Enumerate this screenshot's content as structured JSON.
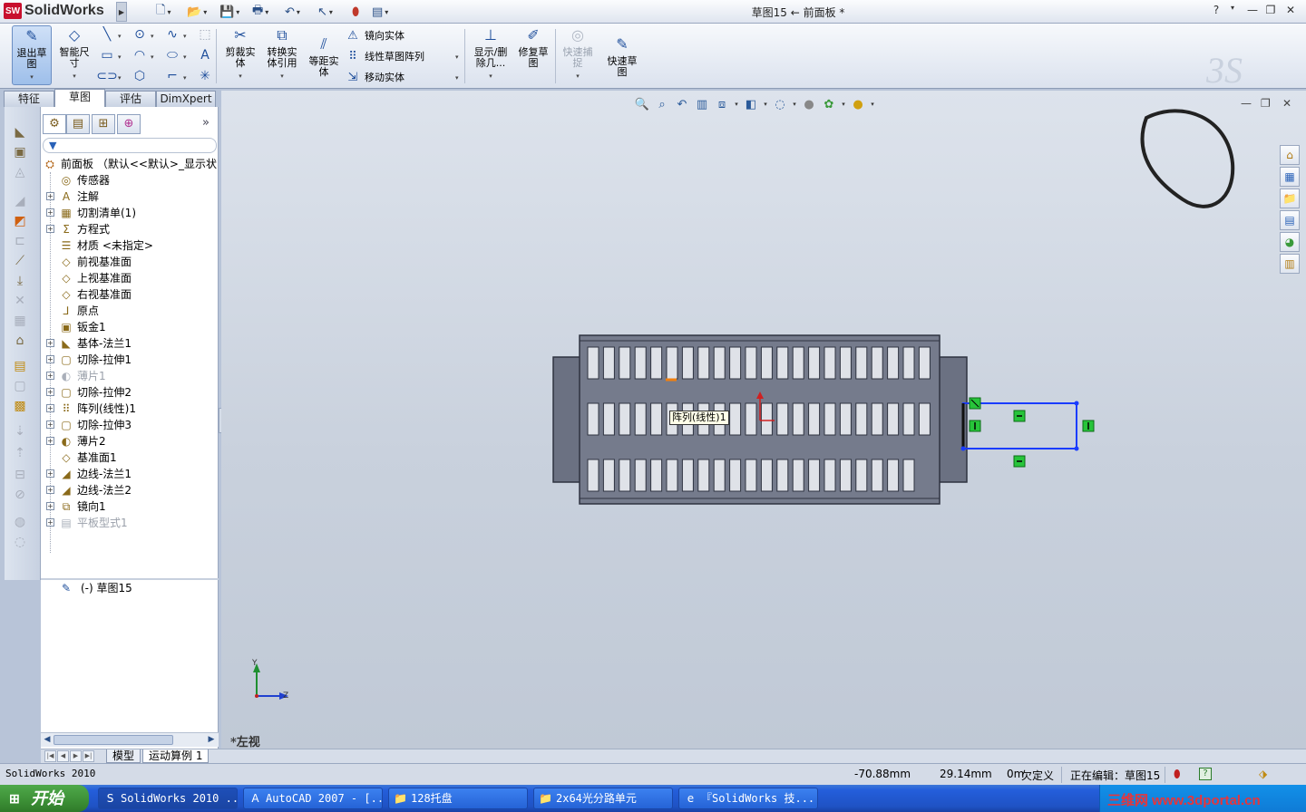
{
  "app": {
    "name": "SolidWorks",
    "document_title": "草图15 ← 前面板 *"
  },
  "window_controls": {
    "help": "?",
    "minimize": "—",
    "restore": "❐",
    "close": "✕"
  },
  "command_manager": {
    "exit_sketch": "退出草图",
    "smart_dimension": "智能尺寸",
    "trim_entities": "剪裁实体",
    "convert_entities": "转换实体引用",
    "offset_entities": "等距实体",
    "mirror_entities": "镜向实体",
    "linear_pattern": "线性草图阵列",
    "move_entities": "移动实体",
    "display_delete_relations": "显示/删除几...",
    "repair_sketch": "修复草图",
    "quick_snaps": "快速捕捉",
    "rapid_sketch": "快速草图"
  },
  "tabs": [
    "特征",
    "草图",
    "评估",
    "DimXpert"
  ],
  "active_tab": "草图",
  "feature_tree": {
    "root": "前面板 （默认<<默认>_显示状",
    "items": [
      {
        "label": "传感器",
        "expandable": false,
        "dim": false,
        "icon": "sensor-icon"
      },
      {
        "label": "注解",
        "expandable": true,
        "dim": false,
        "icon": "annotation-icon"
      },
      {
        "label": "切割清单(1)",
        "expandable": true,
        "dim": false,
        "icon": "cutlist-icon"
      },
      {
        "label": "方程式",
        "expandable": true,
        "dim": false,
        "icon": "equation-icon"
      },
      {
        "label": "材质 <未指定>",
        "expandable": false,
        "dim": false,
        "icon": "material-icon"
      },
      {
        "label": "前视基准面",
        "expandable": false,
        "dim": false,
        "icon": "plane-icon"
      },
      {
        "label": "上视基准面",
        "expandable": false,
        "dim": false,
        "icon": "plane-icon"
      },
      {
        "label": "右视基准面",
        "expandable": false,
        "dim": false,
        "icon": "plane-icon"
      },
      {
        "label": "原点",
        "expandable": false,
        "dim": false,
        "icon": "origin-icon"
      },
      {
        "label": "钣金1",
        "expandable": false,
        "dim": false,
        "icon": "sheetmetal-icon"
      },
      {
        "label": "基体-法兰1",
        "expandable": true,
        "dim": false,
        "icon": "base-flange-icon"
      },
      {
        "label": "切除-拉伸1",
        "expandable": true,
        "dim": false,
        "icon": "cut-extrude-icon"
      },
      {
        "label": "薄片1",
        "expandable": true,
        "dim": true,
        "icon": "tab-icon"
      },
      {
        "label": "切除-拉伸2",
        "expandable": true,
        "dim": false,
        "icon": "cut-extrude-icon"
      },
      {
        "label": "阵列(线性)1",
        "expandable": true,
        "dim": false,
        "icon": "linear-pattern-icon"
      },
      {
        "label": "切除-拉伸3",
        "expandable": true,
        "dim": false,
        "icon": "cut-extrude-icon"
      },
      {
        "label": "薄片2",
        "expandable": true,
        "dim": false,
        "icon": "tab-icon"
      },
      {
        "label": "基准面1",
        "expandable": false,
        "dim": false,
        "icon": "plane-icon"
      },
      {
        "label": "边线-法兰1",
        "expandable": true,
        "dim": false,
        "icon": "edge-flange-icon"
      },
      {
        "label": "边线-法兰2",
        "expandable": true,
        "dim": false,
        "icon": "edge-flange-icon"
      },
      {
        "label": "镜向1",
        "expandable": true,
        "dim": false,
        "icon": "mirror-icon"
      },
      {
        "label": "平板型式1",
        "expandable": true,
        "dim": true,
        "icon": "flat-pattern-icon"
      }
    ],
    "sketch_item": "(-) 草图15"
  },
  "bottom_tabs": [
    "模型",
    "运动算例 1"
  ],
  "viewport": {
    "view_name": "*左视",
    "tooltip": "阵列(线性)1",
    "axis_y": "Y",
    "axis_z": "Z"
  },
  "status_bar": {
    "app_label": "SolidWorks 2010",
    "x_coord": "-70.88mm",
    "y_coord": "29.14mm",
    "z_coord": "0m",
    "sketch_state": "欠定义",
    "editing": "正在编辑：草图15",
    "help_mark": "?"
  },
  "taskbar": {
    "start": "开始",
    "items": [
      {
        "label": "SolidWorks 2010 ...",
        "icon": "solidworks-icon",
        "active": true
      },
      {
        "label": "AutoCAD 2007 - [...",
        "icon": "autocad-icon",
        "active": false
      },
      {
        "label": "128托盘",
        "icon": "folder-icon",
        "active": false
      },
      {
        "label": "2x64光分路单元",
        "icon": "folder-icon",
        "active": false
      },
      {
        "label": "『SolidWorks 技...",
        "icon": "ie-icon",
        "active": false
      }
    ],
    "tray_text": "三维网 www.3dportal.cn"
  }
}
